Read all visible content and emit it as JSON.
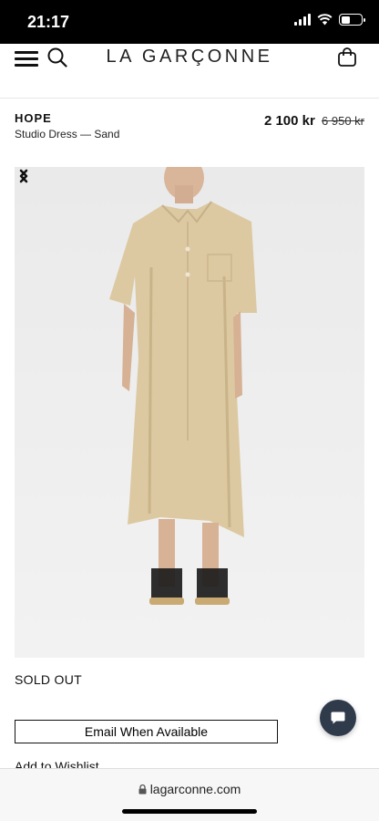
{
  "status_bar": {
    "time": "21:17",
    "battery_level": 0.45
  },
  "header": {
    "logo": "LA GARÇONNE",
    "icons": [
      "menu-icon",
      "search-icon",
      "bag-icon"
    ]
  },
  "product": {
    "brand": "HOPE",
    "name": "Studio Dress — Sand",
    "price_sale": "2 100 kr",
    "price_original": "6 950 kr"
  },
  "gallery": {
    "icons": [
      "chevron-left-icon",
      "chevron-right-icon"
    ]
  },
  "stock_status": "SOLD OUT",
  "actions": {
    "email_button": "Email When Available",
    "wishlist": "Add to Wishlist"
  },
  "chat": {
    "icon": "chat-bubble-icon"
  },
  "browser": {
    "url": "lagarconne.com"
  }
}
